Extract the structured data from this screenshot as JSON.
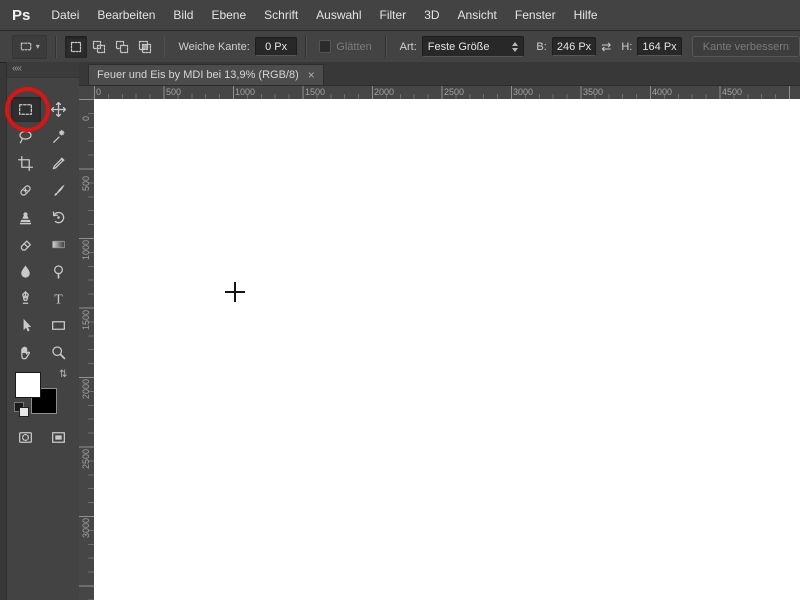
{
  "app": {
    "logo": "Ps"
  },
  "menubar": {
    "items": [
      "Datei",
      "Bearbeiten",
      "Bild",
      "Ebene",
      "Schrift",
      "Auswahl",
      "Filter",
      "3D",
      "Ansicht",
      "Fenster",
      "Hilfe"
    ]
  },
  "options": {
    "feather_label": "Weiche Kante:",
    "feather_value": "0 Px",
    "antialias_label": "Glätten",
    "style_label": "Art:",
    "style_value": "Feste Größe",
    "width_label": "B:",
    "width_value": "246 Px",
    "height_label": "H:",
    "height_value": "164 Px",
    "refine_edge_label": "Kante verbessern"
  },
  "tool_panel": {
    "collapse_glyph": "««",
    "tools": [
      "rectangular-marquee",
      "move",
      "lasso",
      "magic-wand",
      "crop",
      "eyedropper",
      "healing-brush",
      "brush",
      "clone-stamp",
      "history-brush",
      "eraser",
      "gradient",
      "blur",
      "dodge",
      "pen",
      "type",
      "path-selection",
      "rectangle-shape",
      "hand",
      "zoom"
    ],
    "extras": [
      "quick-mask-mode",
      "screen-mode"
    ],
    "foreground_color": "#ffffff",
    "background_color": "#000000",
    "active_tool": "rectangular-marquee"
  },
  "document": {
    "tab_title": "Feuer und Eis by MDI bei 13,9% (RGB/8)",
    "close_glyph": "×",
    "zoom_percent": "13,9%",
    "color_mode": "RGB/8"
  },
  "rulers": {
    "horizontal_labels": [
      "0",
      "500",
      "1000",
      "1500",
      "2000",
      "2500",
      "3000",
      "3500",
      "4000",
      "4500"
    ],
    "vertical_labels": [
      "0",
      "500",
      "1000",
      "1500",
      "2000",
      "2500",
      "3000"
    ]
  },
  "annotation": {
    "highlight_circle_color": "#e01212",
    "highlighted_tool": "rectangular-marquee"
  }
}
